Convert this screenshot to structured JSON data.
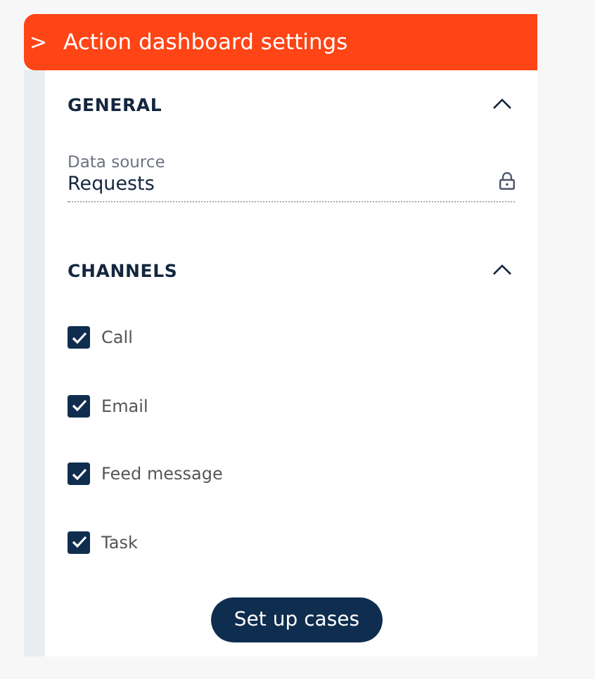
{
  "header": {
    "title": "Action dashboard settings",
    "toggle_icon": ">"
  },
  "sections": [
    {
      "title": "GENERAL",
      "expanded": true,
      "kind": "fields",
      "fields": [
        {
          "label": "Data source",
          "value": "Requests",
          "locked": true
        }
      ]
    },
    {
      "title": "CHANNELS",
      "expanded": true,
      "kind": "checkboxes",
      "items": [
        {
          "label": "Call",
          "checked": true
        },
        {
          "label": "Email",
          "checked": true
        },
        {
          "label": "Feed message",
          "checked": true
        },
        {
          "label": "Task",
          "checked": true
        }
      ]
    }
  ],
  "button": {
    "label": "Set up cases"
  }
}
